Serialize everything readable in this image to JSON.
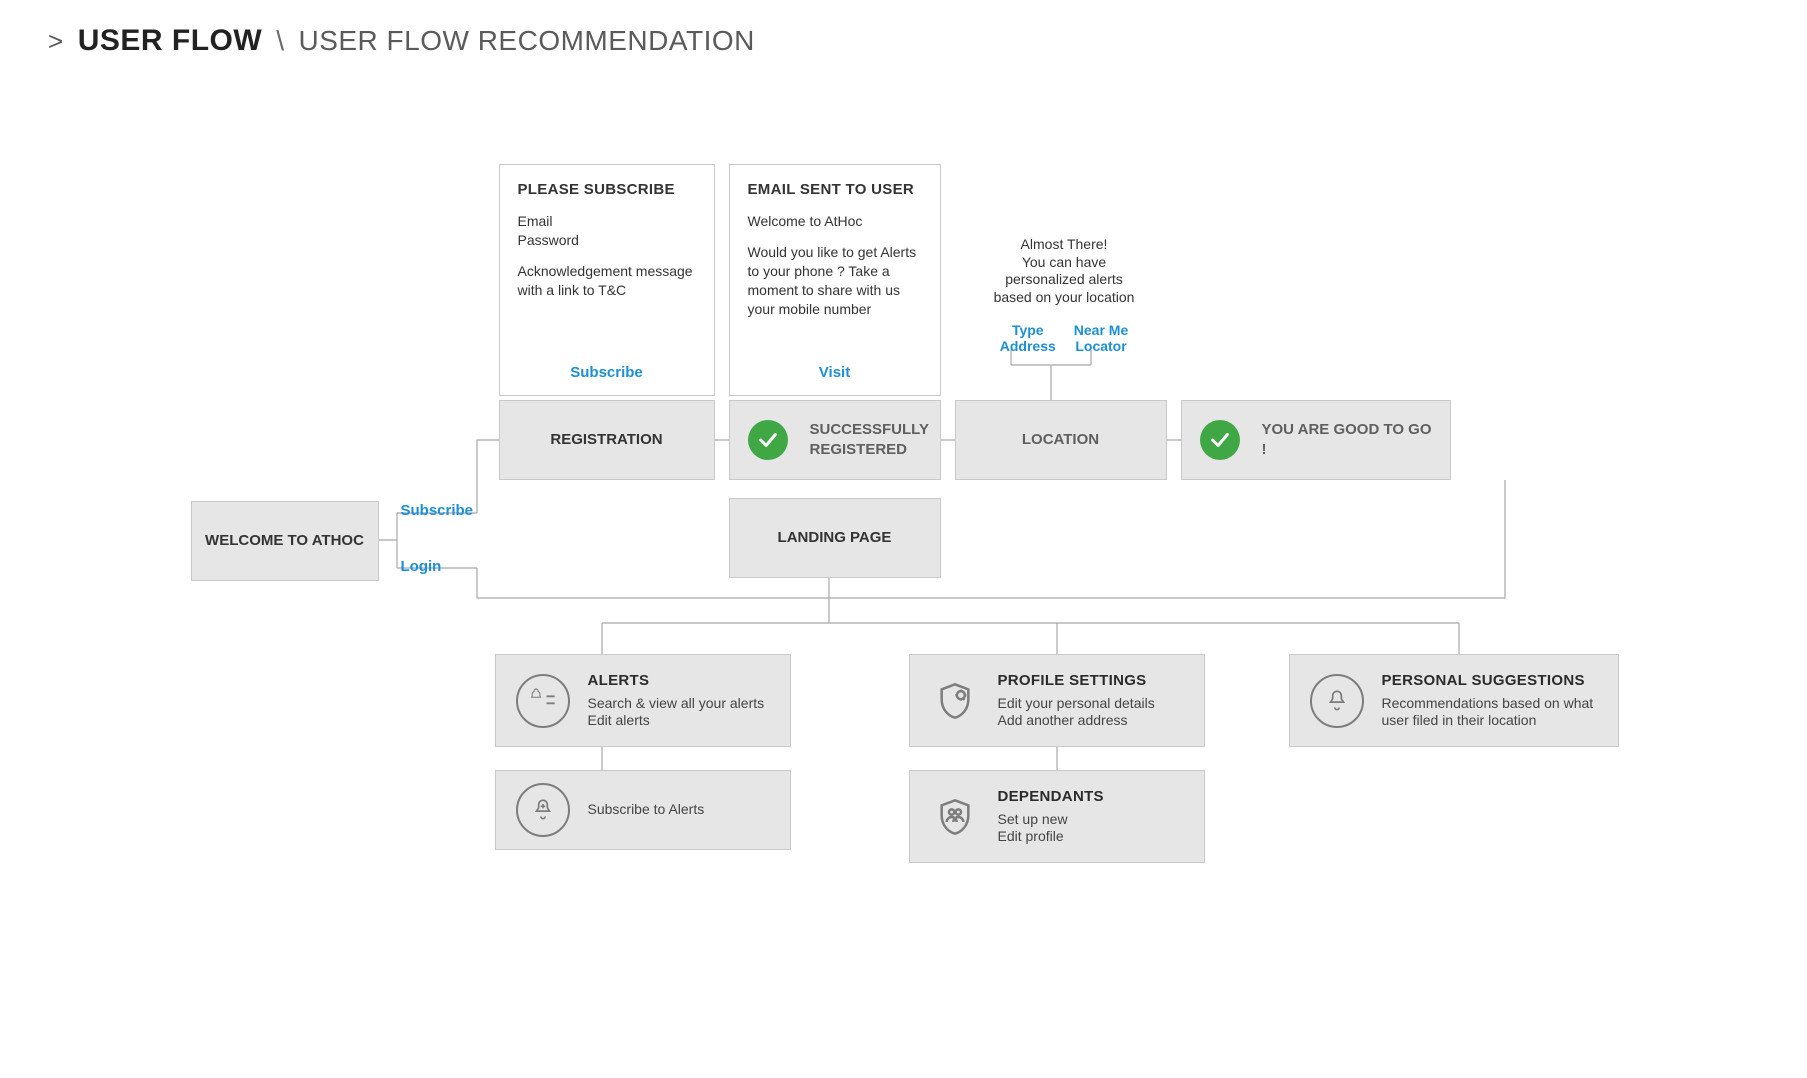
{
  "header": {
    "prefix": ">",
    "main": "USER FLOW",
    "separator": "\\",
    "sub": "USER FLOW RECOMMENDATION"
  },
  "welcome_box": "WELCOME TO ATHOC",
  "branch_labels": {
    "subscribe": "Subscribe",
    "login": "Login"
  },
  "subscribe_card": {
    "title": "PLEASE SUBSCRIBE",
    "line1": "Email",
    "line2": "Password",
    "line3": "Acknowledgement message with a link to T&C",
    "cta": "Subscribe"
  },
  "email_card": {
    "title": "EMAIL SENT TO USER",
    "line1": "Welcome to AtHoc",
    "line2": "Would you like to get Alerts to your phone ? Take a moment to share with us your mobile number",
    "cta": "Visit"
  },
  "location_callout": {
    "text": "Almost There!\nYou can have\npersonalized alerts\nbased on your location",
    "linkA": "Type\nAddress",
    "linkB": "Near Me\nLocator"
  },
  "steps": {
    "registration": "REGISTRATION",
    "success": "SUCCESSFULLY REGISTERED",
    "location": "LOCATION",
    "good": "YOU  ARE GOOD TO GO !",
    "landing": "LANDING PAGE"
  },
  "features": {
    "alerts": {
      "title": "ALERTS",
      "desc": "Search & view all your alerts\nEdit alerts"
    },
    "alerts_sub": {
      "title": "",
      "desc": "Subscribe to Alerts"
    },
    "profile": {
      "title": "PROFILE SETTINGS",
      "desc": "Edit your personal details\nAdd another address"
    },
    "dependants": {
      "title": "DEPENDANTS",
      "desc": "Set up new\nEdit profile"
    },
    "personal": {
      "title": "PERSONAL SUGGESTIONS",
      "desc": "Recommendations based on what user filed in their location"
    }
  }
}
